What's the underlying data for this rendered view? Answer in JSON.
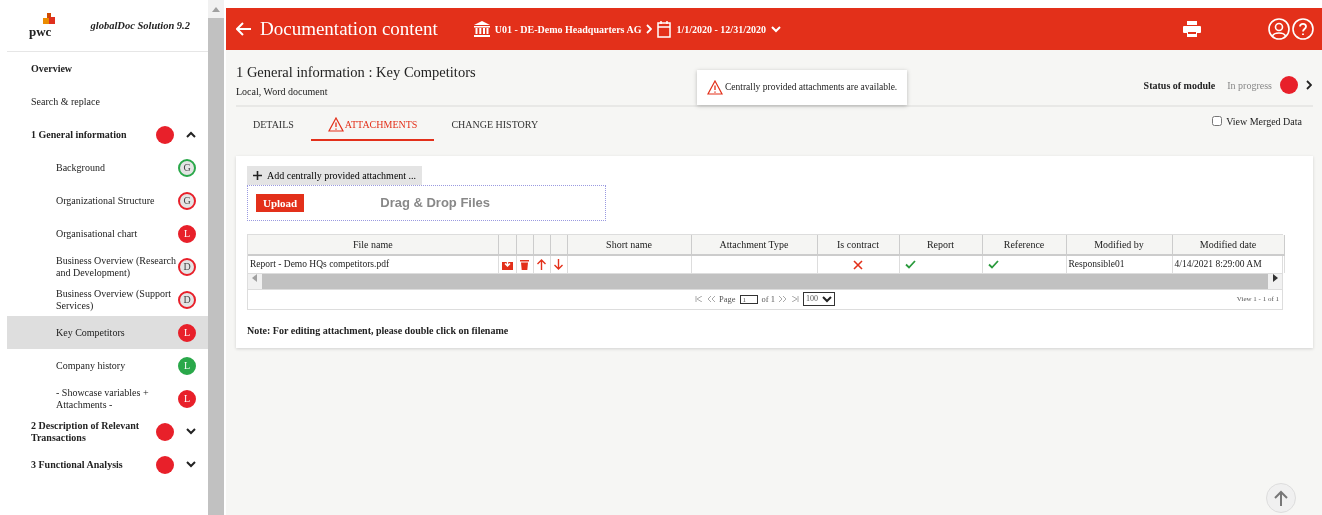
{
  "sidebar": {
    "logo": "pwc",
    "product": "globalDoc Solution 9.2",
    "items": [
      {
        "label": "Overview",
        "kind": "link",
        "bold": true
      },
      {
        "label": "Search & replace",
        "kind": "link",
        "bold": false
      },
      {
        "label": "1 General information",
        "kind": "section",
        "color": "#e8202a",
        "expanded": true,
        "children": [
          {
            "label": "Background",
            "badge": "G",
            "kind": "outline",
            "color": "#2aa84a",
            "selected": false
          },
          {
            "label": "Organizational Structure",
            "badge": "G",
            "kind": "outline",
            "color": "#e8202a",
            "selected": false
          },
          {
            "label": "Organisational chart",
            "badge": "L",
            "kind": "filled",
            "color": "#e8202a",
            "selected": false
          },
          {
            "label": "Business Overview (Research and Development)",
            "badge": "D",
            "kind": "outline",
            "color": "#e8202a",
            "selected": false
          },
          {
            "label": "Business Overview (Support Services)",
            "badge": "D",
            "kind": "outline",
            "color": "#e8202a",
            "selected": false
          },
          {
            "label": "Key Competitors",
            "badge": "L",
            "kind": "filled",
            "color": "#e8202a",
            "selected": true
          },
          {
            "label": "Company history",
            "badge": "L",
            "kind": "filled",
            "color": "#2aa84a",
            "selected": false
          },
          {
            "label": "- Showcase variables + Attachments -",
            "badge": "L",
            "kind": "filled",
            "color": "#e8202a",
            "selected": false
          }
        ]
      },
      {
        "label": "2 Description of Relevant Transactions",
        "kind": "section",
        "color": "#e8202a",
        "expanded": false
      },
      {
        "label": "3 Functional Analysis",
        "kind": "section",
        "color": "#e8202a",
        "expanded": false
      }
    ]
  },
  "header": {
    "title": "Documentation content",
    "entity": "U01 - DE-Demo Headquarters AG",
    "period": "1/1/2020 - 12/31/2020"
  },
  "page": {
    "title": "1 General information : Key Competitors",
    "subtitle": "Local, Word document",
    "notice": "Centrally provided attachments are available.",
    "status_label": "Status of module",
    "status": "In progress",
    "color": "#e8202a",
    "tabs": [
      {
        "label": "DETAILS",
        "selected": false,
        "warning": false
      },
      {
        "label": "ATTACHMENTS",
        "selected": true,
        "warning": true
      },
      {
        "label": "CHANGE HISTORY",
        "selected": false,
        "warning": false
      }
    ],
    "view_merged": {
      "label": "View Merged Data",
      "checked": false
    }
  },
  "attachments": {
    "add_button": "Add centrally provided attachment ...",
    "upload_button": "Upload",
    "drop_text": "Drag & Drop Files",
    "table": {
      "columns": [
        "File name",
        "Short name",
        "Attachment Type",
        "Is contract",
        "Report",
        "Reference",
        "Modified by",
        "Modified date"
      ],
      "rows": [
        {
          "file_name": "Report - Demo HQs competitors.pdf",
          "is_contract": false,
          "report": true,
          "reference": true,
          "modified_by": "Responsible01",
          "modified_date": "4/14/2021 8:29:00 AM"
        }
      ]
    },
    "pager": {
      "page_label": "Page",
      "page": "1",
      "of": "of 1",
      "page_size": "100",
      "summary": "View 1 - 1 of 1"
    },
    "note": "Note: For editing attachment, please double click on filename"
  }
}
